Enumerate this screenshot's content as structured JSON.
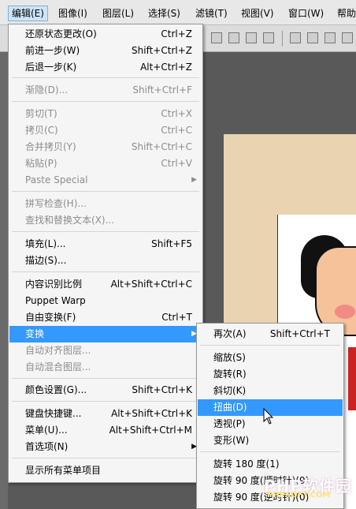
{
  "menubar": {
    "items": [
      {
        "label": "编辑(E)",
        "active": true
      },
      {
        "label": "图像(I)"
      },
      {
        "label": "图层(L)"
      },
      {
        "label": "选择(S)"
      },
      {
        "label": "滤镜(T)"
      },
      {
        "label": "视图(V)"
      },
      {
        "label": "窗口(W)"
      },
      {
        "label": "帮助"
      }
    ]
  },
  "menu": {
    "items": [
      {
        "label": "还原状态更改(O)",
        "shortcut": "Ctrl+Z"
      },
      {
        "label": "前进一步(W)",
        "shortcut": "Shift+Ctrl+Z"
      },
      {
        "label": "后退一步(K)",
        "shortcut": "Alt+Ctrl+Z"
      },
      {
        "label": "渐隐(D)...",
        "shortcut": "Shift+Ctrl+F",
        "disabled": true
      },
      {
        "label": "剪切(T)",
        "shortcut": "Ctrl+X",
        "disabled": true
      },
      {
        "label": "拷贝(C)",
        "shortcut": "Ctrl+C",
        "disabled": true
      },
      {
        "label": "合并拷贝(Y)",
        "shortcut": "Shift+Ctrl+C",
        "disabled": true
      },
      {
        "label": "粘贴(P)",
        "shortcut": "Ctrl+V",
        "disabled": true
      },
      {
        "label": "Paste Special",
        "shortcut": "",
        "disabled": true,
        "submenu": true
      },
      {
        "label": "拼写检查(H)...",
        "shortcut": "",
        "disabled": true
      },
      {
        "label": "查找和替换文本(X)...",
        "shortcut": "",
        "disabled": true
      },
      {
        "label": "填充(L)...",
        "shortcut": "Shift+F5"
      },
      {
        "label": "描边(S)...",
        "shortcut": ""
      },
      {
        "label": "内容识别比例",
        "shortcut": "Alt+Shift+Ctrl+C"
      },
      {
        "label": "Puppet Warp",
        "shortcut": ""
      },
      {
        "label": "自由变换(F)",
        "shortcut": "Ctrl+T"
      },
      {
        "label": "变换",
        "shortcut": "",
        "submenu": true,
        "highlight": true
      },
      {
        "label": "自动对齐图层...",
        "shortcut": "",
        "disabled": true
      },
      {
        "label": "自动混合图层...",
        "shortcut": "",
        "disabled": true
      },
      {
        "label": "颜色设置(G)...",
        "shortcut": "Shift+Ctrl+K"
      },
      {
        "label": "键盘快捷键...",
        "shortcut": "Alt+Shift+Ctrl+K"
      },
      {
        "label": "菜单(U)...",
        "shortcut": "Alt+Shift+Ctrl+M"
      },
      {
        "label": "首选项(N)",
        "shortcut": "",
        "submenu": true
      },
      {
        "label": "显示所有菜单项目",
        "shortcut": ""
      }
    ],
    "submenu_arrow": "▶"
  },
  "transform_submenu": {
    "items": [
      {
        "label": "再次(A)",
        "shortcut": "Shift+Ctrl+T"
      },
      {
        "label": "缩放(S)",
        "shortcut": ""
      },
      {
        "label": "旋转(R)",
        "shortcut": ""
      },
      {
        "label": "斜切(K)",
        "shortcut": ""
      },
      {
        "label": "扭曲(D)",
        "shortcut": "",
        "highlight": true
      },
      {
        "label": "透视(P)",
        "shortcut": ""
      },
      {
        "label": "变形(W)",
        "shortcut": ""
      },
      {
        "label": "旋转 180 度(1)",
        "shortcut": ""
      },
      {
        "label": "旋转 90 度(顺时针)(9)",
        "shortcut": ""
      },
      {
        "label": "旋转 90 度(逆时针)(0)",
        "shortcut": ""
      }
    ]
  },
  "watermark": {
    "text": "PHP软件园",
    "subtext": "PHPSOFT.COM"
  },
  "colors": {
    "highlight": "#3399ff",
    "menu_bg": "#f5f5f5",
    "disabled_text": "#8c8c8c",
    "canvas": "#e9d3b1"
  }
}
